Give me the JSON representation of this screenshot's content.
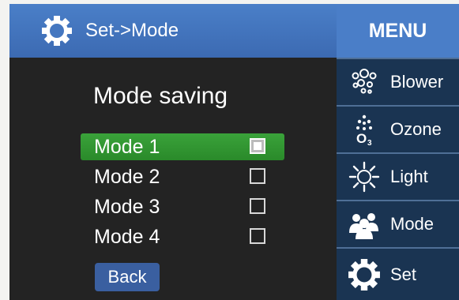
{
  "header": {
    "title": "Set->Mode",
    "menu_label": "MENU",
    "icon": "gear-icon"
  },
  "main": {
    "heading": "Mode saving",
    "modes": [
      {
        "label": "Mode 1",
        "checked": true
      },
      {
        "label": "Mode 2",
        "checked": false
      },
      {
        "label": "Mode 3",
        "checked": false
      },
      {
        "label": "Mode 4",
        "checked": false
      }
    ],
    "back_label": "Back"
  },
  "menu": {
    "items": [
      {
        "label": "Blower",
        "icon": "blower-icon"
      },
      {
        "label": "Ozone",
        "icon": "ozone-icon"
      },
      {
        "label": "Light",
        "icon": "light-icon"
      },
      {
        "label": "Mode",
        "icon": "people-icon"
      },
      {
        "label": "Set",
        "icon": "gear-icon"
      }
    ]
  },
  "colors": {
    "title_bar": "#4a7fc8",
    "selected_row": "#2f962f",
    "menu_item": "#1a3452",
    "back_button": "#3a5fa0",
    "screen_bg": "#232323"
  }
}
